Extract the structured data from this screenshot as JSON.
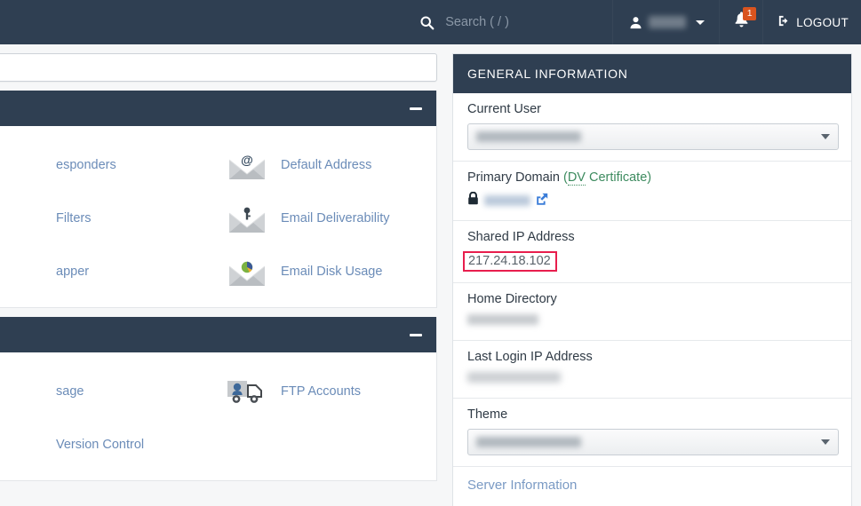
{
  "topbar": {
    "search_placeholder": "Search ( / )",
    "search_value": "",
    "search_icon": "search-icon",
    "user_icon": "user-icon",
    "user_name_redacted": "",
    "notifications_badge": "1",
    "bell_icon": "bell-icon",
    "logout_label": "LOGOUT",
    "logout_icon": "sign-out-icon",
    "background_color": "#2f3f52"
  },
  "left": {
    "tools_search_value": "",
    "tools_search_placeholder": "",
    "panels": [
      {
        "title": "",
        "collapse_icon": "minus-icon",
        "items": [
          {
            "label": "esponders",
            "icon": "envelope-autoresponders-icon",
            "truncated": true
          },
          {
            "label": "Default Address",
            "icon": "envelope-at-icon",
            "truncated": false
          },
          {
            "label": "Filters",
            "icon": "envelope-filters-icon",
            "truncated": true
          },
          {
            "label": "Email Deliverability",
            "icon": "envelope-key-icon",
            "truncated": false
          },
          {
            "label": "apper",
            "icon": "envelope-boxtrapper-icon",
            "truncated": true
          },
          {
            "label": "Email Disk Usage",
            "icon": "envelope-piechart-icon",
            "truncated": false
          }
        ]
      },
      {
        "title": "",
        "collapse_icon": "minus-icon",
        "items": [
          {
            "label": "sage",
            "icon": "disk-usage-icon",
            "truncated": true
          },
          {
            "label": "FTP Accounts",
            "icon": "ftp-truck-icon",
            "truncated": false
          },
          {
            "label": "Version Control",
            "icon": "git-icon",
            "truncated": true
          }
        ]
      }
    ]
  },
  "general_information": {
    "title": "GENERAL INFORMATION",
    "rows": [
      {
        "key": "current_user",
        "label": "Current User",
        "type": "select",
        "value_redacted": true
      },
      {
        "key": "primary_domain",
        "label": "Primary Domain",
        "suffix_label": "(DV Certificate)",
        "suffix_abbr": "DV",
        "suffix_rest": " Certificate)",
        "suffix_open": "(",
        "type": "domain",
        "lock_icon": "lock-icon",
        "external_link_icon": "external-link-icon",
        "value_redacted": true
      },
      {
        "key": "shared_ip_address",
        "label": "Shared IP Address",
        "type": "text",
        "value": "217.24.18.102",
        "highlighted": true,
        "highlight_color": "#e81e4d"
      },
      {
        "key": "home_directory",
        "label": "Home Directory",
        "type": "text",
        "value_redacted": true
      },
      {
        "key": "last_login_ip_address",
        "label": "Last Login IP Address",
        "type": "text",
        "value_redacted": true
      },
      {
        "key": "theme",
        "label": "Theme",
        "type": "select",
        "value_redacted": true
      }
    ],
    "server_information_link": "Server Information"
  },
  "colors": {
    "header_dark": "#2f3f52",
    "link_blue": "#6b8cb8",
    "cert_green": "#3d8b5f",
    "highlight_red": "#e81e4d",
    "badge_orange": "#d9541f"
  }
}
